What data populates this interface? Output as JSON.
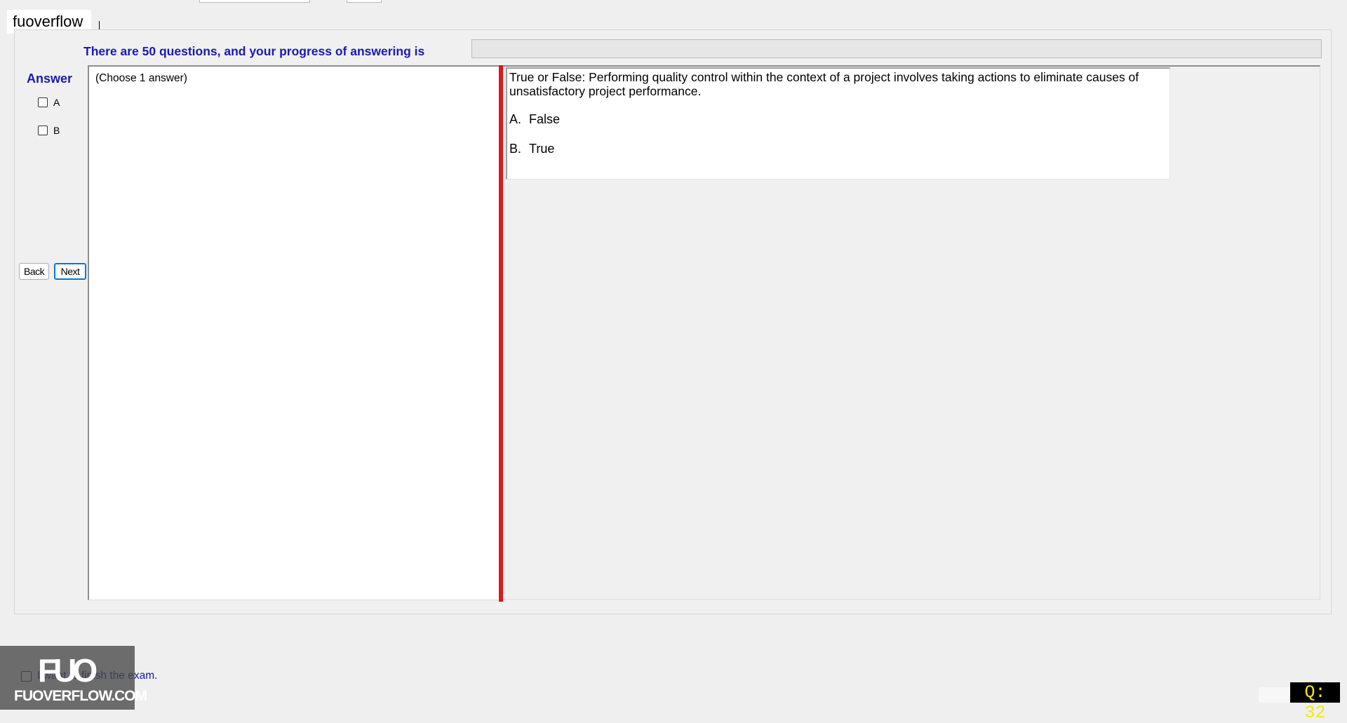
{
  "watermark": {
    "label": "fuoverflow"
  },
  "header": {
    "progress_text": "There are 50 questions, and your progress of answering is",
    "progress_fraction": 0
  },
  "answer_panel": {
    "title": "Answer",
    "options": [
      {
        "label": "A"
      },
      {
        "label": "B"
      }
    ]
  },
  "nav": {
    "back_label": "Back",
    "next_label": "Next"
  },
  "left_pane": {
    "hint": "(Choose 1 answer)"
  },
  "question": {
    "text": "True or False: Performing quality control within the context of a project involves taking actions to eliminate causes of unsatisfactory project performance.",
    "options": [
      {
        "letter": "A.",
        "text": "False"
      },
      {
        "letter": "B.",
        "text": "True"
      }
    ]
  },
  "footer": {
    "finish_label": "I want to finish the exam.",
    "logo_text": "FUOVERFLOW.COM",
    "logo_mark": "FUO",
    "question_counter": "Q: 32"
  },
  "colors": {
    "accent_text": "#1a1ab0",
    "splitter": "#d71a1a",
    "counter_text": "#f1e61a"
  }
}
